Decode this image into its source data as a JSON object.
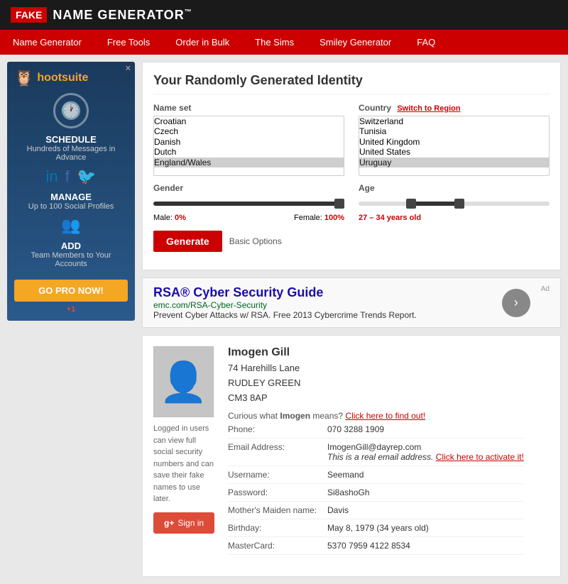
{
  "header": {
    "fake_badge": "FAKE",
    "site_title": "NAME GENERATOR",
    "tm": "™"
  },
  "nav": {
    "items": [
      {
        "label": "Name Generator",
        "id": "name-generator"
      },
      {
        "label": "Free Tools",
        "id": "free-tools"
      },
      {
        "label": "Order in Bulk",
        "id": "order-in-bulk"
      },
      {
        "label": "The Sims",
        "id": "the-sims"
      },
      {
        "label": "Smiley Generator",
        "id": "smiley-generator"
      },
      {
        "label": "FAQ",
        "id": "faq"
      }
    ]
  },
  "sidebar": {
    "ad": {
      "logo_text": "hootsuite",
      "schedule_title": "SCHEDULE",
      "schedule_desc": "Hundreds of Messages in Advance",
      "manage_title": "MANAGE",
      "manage_desc": "Up to 100 Social Profiles",
      "add_title": "ADD",
      "add_desc": "Team Members to Your Accounts",
      "go_pro_label": "GO PRO NOW!",
      "gplus_label": "+1"
    }
  },
  "identity": {
    "title": "Your Randomly Generated Identity",
    "name_set_label": "Name set",
    "country_label": "Country",
    "switch_to_region": "Switch to Region",
    "name_set_options": [
      "Croatian",
      "Czech",
      "Danish",
      "Dutch",
      "England/Wales"
    ],
    "country_options": [
      "Switzerland",
      "Tunisia",
      "United Kingdom",
      "United States",
      "Uruguay"
    ],
    "gender_label": "Gender",
    "age_label": "Age",
    "male_label": "Male:",
    "male_pct": "0%",
    "female_label": "Female:",
    "female_pct": "100%",
    "age_range": "27 – 34 years old",
    "generate_label": "Generate",
    "basic_options_label": "Basic Options"
  },
  "ad_banner": {
    "ad_label": "Ad",
    "title": "RSA® Cyber Security Guide",
    "url": "emc.com/RSA-Cyber-Security",
    "description": "Prevent Cyber Attacks w/ RSA. Free 2013 Cybercrime Trends Report."
  },
  "profile": {
    "name": "Imogen Gill",
    "address_line1": "74 Harehills Lane",
    "address_line2": "RUDLEY GREEN",
    "address_line3": "CM3 8AP",
    "name_meaning_prefix": "Curious what ",
    "name_highlight": "Imogen",
    "name_meaning_suffix": " means?",
    "name_meaning_link": "Click here to find out!",
    "details": [
      {
        "label": "Phone:",
        "value": "070 3288 1909",
        "type": "normal"
      },
      {
        "label": "Email Address:",
        "value": "ImogenGill@dayrep.com",
        "type": "email",
        "note": "This is a real email address.",
        "link": "Click here to activate it!"
      },
      {
        "label": "Username:",
        "value": "Seemand",
        "type": "normal"
      },
      {
        "label": "Password:",
        "value": "Si8ashoGh",
        "type": "normal"
      },
      {
        "label": "Mother's Maiden name:",
        "value": "Davis",
        "type": "normal"
      },
      {
        "label": "Birthday:",
        "value": "May 8, 1979 (34 years old)",
        "type": "normal"
      },
      {
        "label": "MasterCard:",
        "value": "5370 7959 4122 8534",
        "type": "normal"
      }
    ],
    "logged_out_notice": "Logged in users can view full social security numbers and can save their fake names to use later.",
    "signin_label": "Sign in"
  }
}
